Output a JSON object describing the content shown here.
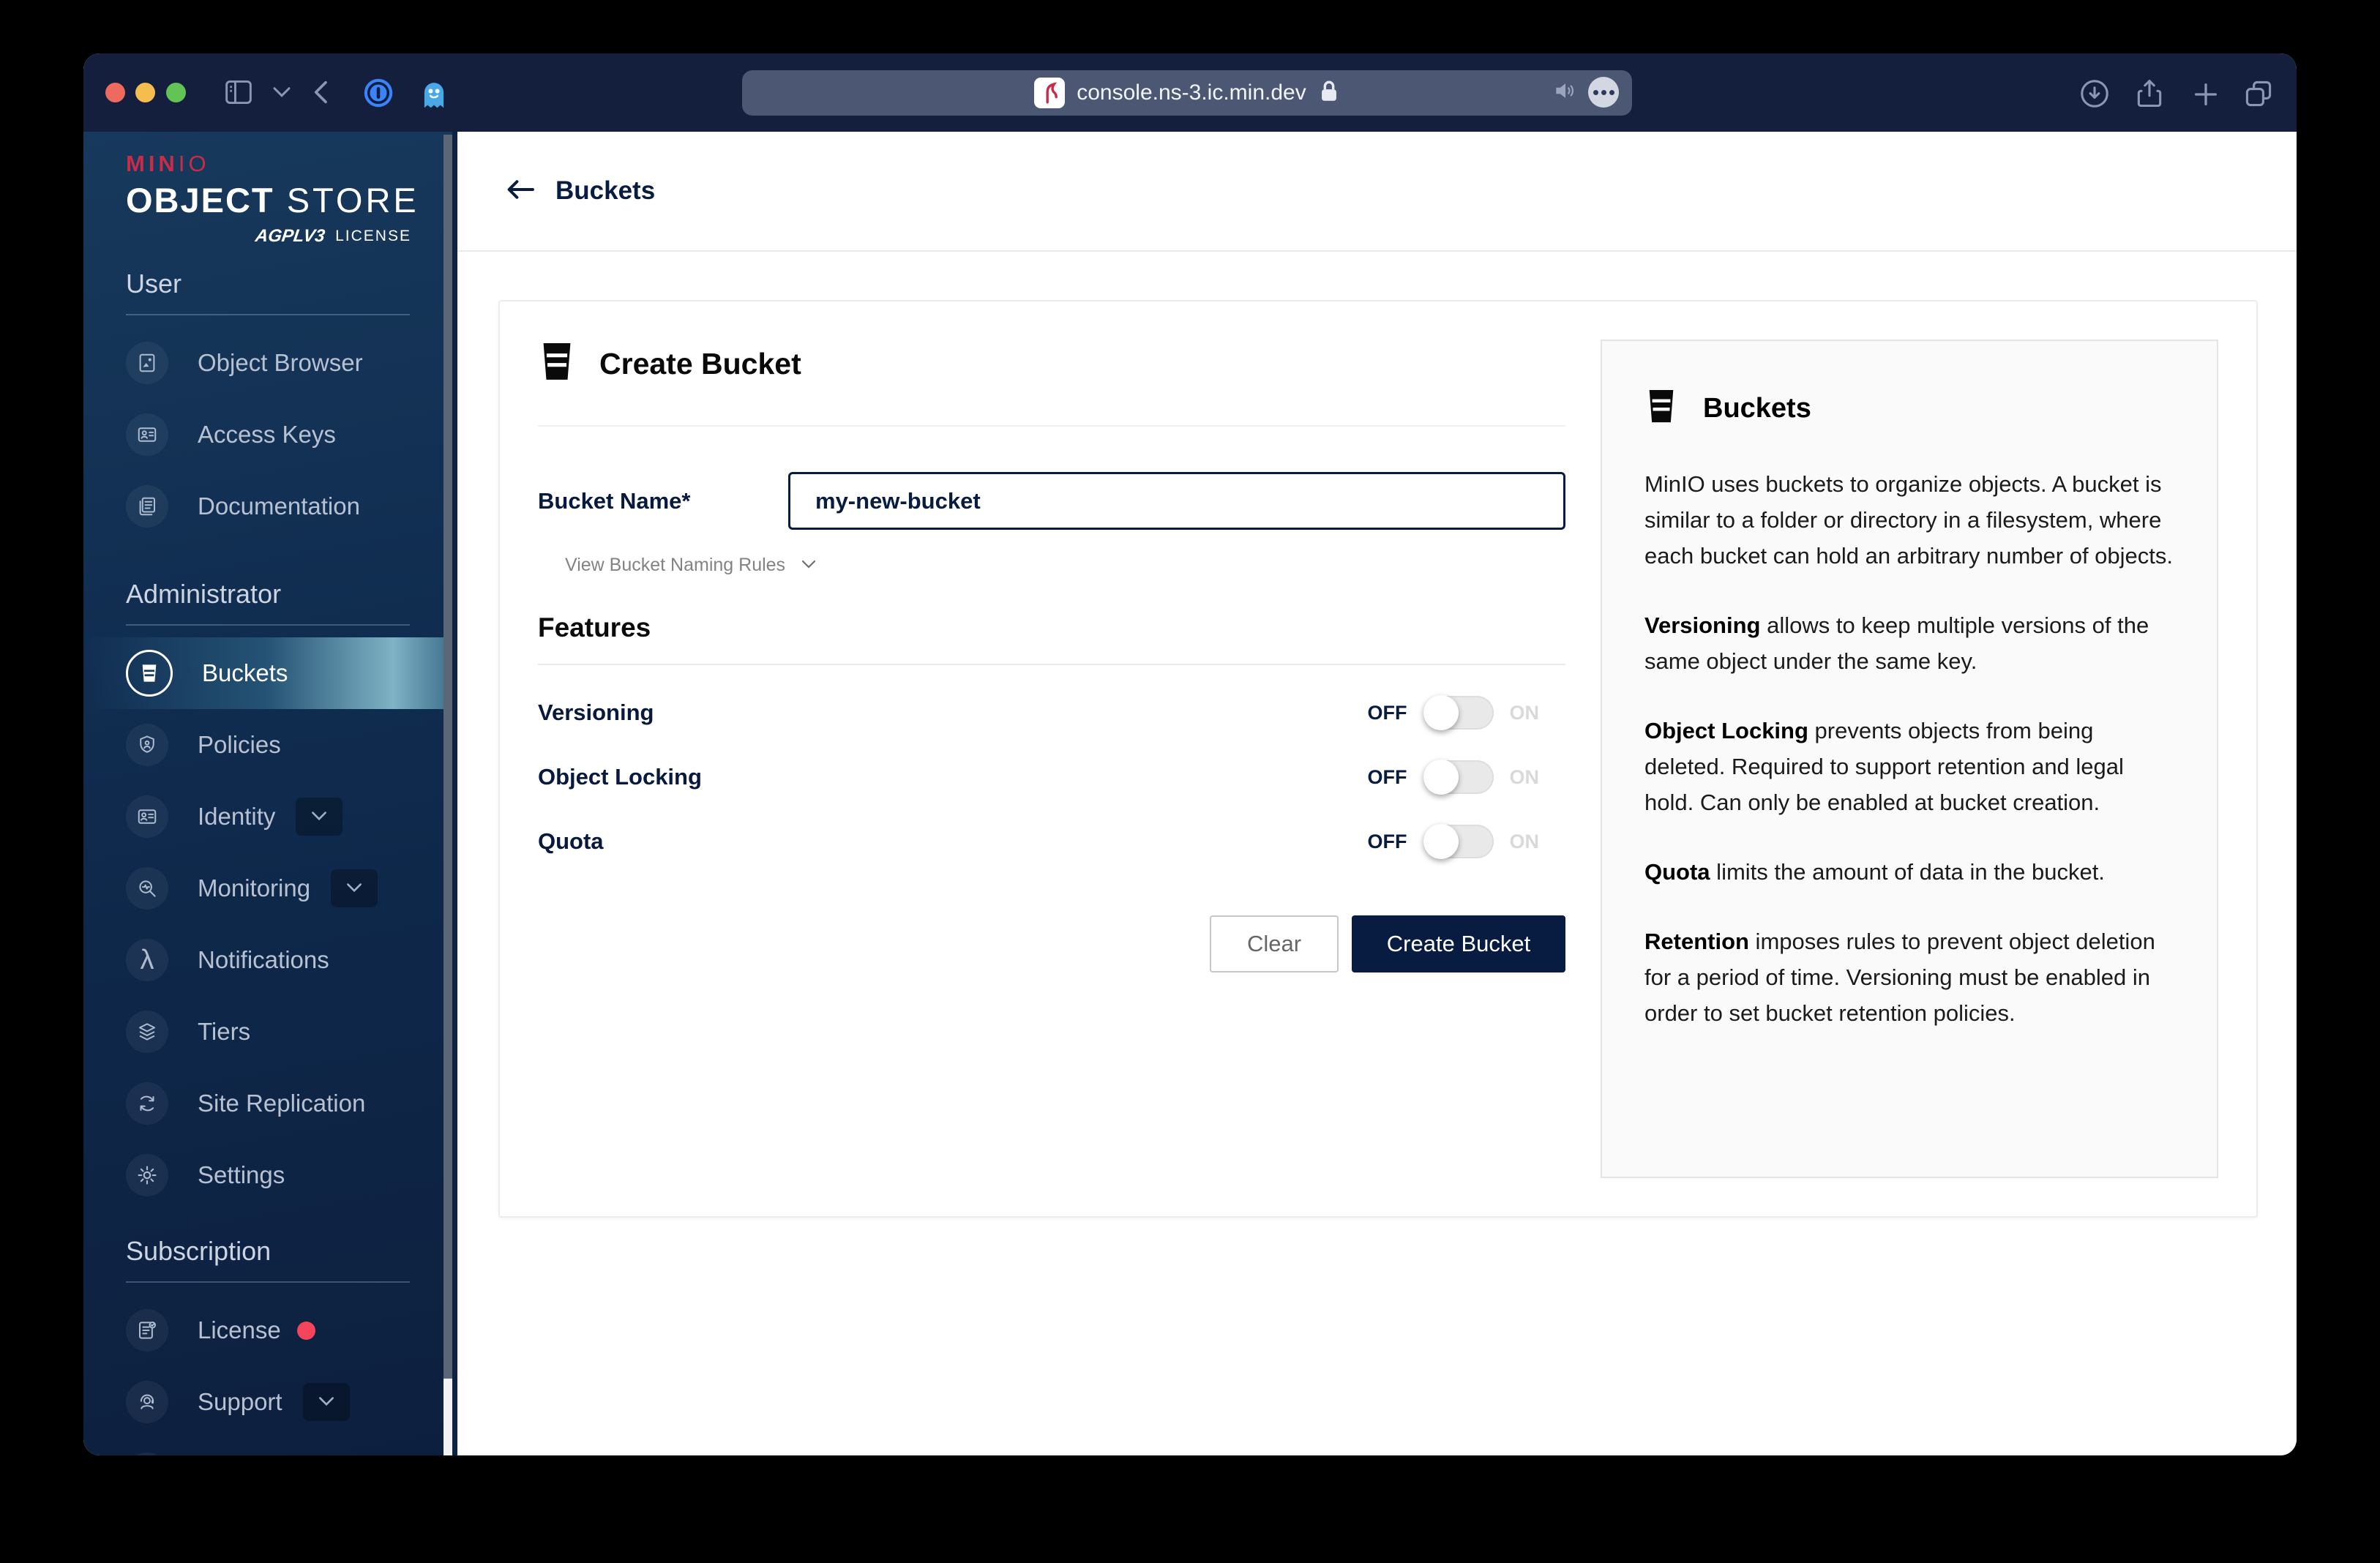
{
  "browser": {
    "url": "console.ns-3.ic.min.dev"
  },
  "logo": {
    "min": "MIN",
    "io": "IO",
    "object": "OBJECT",
    "store": " STORE",
    "agpl": "AGPLV3",
    "license": "LICENSE"
  },
  "sidebar": {
    "sections": [
      {
        "title": "User",
        "items": [
          {
            "label": "Object Browser"
          },
          {
            "label": "Access Keys"
          },
          {
            "label": "Documentation"
          }
        ]
      },
      {
        "title": "Administrator",
        "items": [
          {
            "label": "Buckets"
          },
          {
            "label": "Policies"
          },
          {
            "label": "Identity"
          },
          {
            "label": "Monitoring"
          },
          {
            "label": "Notifications"
          },
          {
            "label": "Tiers"
          },
          {
            "label": "Site Replication"
          },
          {
            "label": "Settings"
          }
        ]
      },
      {
        "title": "Subscription",
        "items": [
          {
            "label": "License"
          },
          {
            "label": "Support"
          }
        ]
      }
    ]
  },
  "page": {
    "title": "Buckets"
  },
  "form": {
    "title": "Create Bucket",
    "bucket_name_label": "Bucket Name*",
    "bucket_name_value": "my-new-bucket",
    "naming_rules_label": "View Bucket Naming Rules",
    "features_title": "Features",
    "toggles": [
      {
        "label": "Versioning"
      },
      {
        "label": "Object Locking"
      },
      {
        "label": "Quota"
      }
    ],
    "off": "OFF",
    "on": "ON",
    "clear_label": "Clear",
    "submit_label": "Create Bucket"
  },
  "info": {
    "title": "Buckets",
    "paragraphs": [
      {
        "bold": "",
        "text": "MinIO uses buckets to organize objects. A bucket is similar to a folder or directory in a filesystem, where each bucket can hold an arbitrary number of objects."
      },
      {
        "bold": "Versioning",
        "text": " allows to keep multiple versions of the same object under the same key."
      },
      {
        "bold": "Object Locking",
        "text": " prevents objects from being deleted. Required to support retention and legal hold. Can only be enabled at bucket creation."
      },
      {
        "bold": "Quota",
        "text": " limits the amount of data in the bucket."
      },
      {
        "bold": "Retention",
        "text": " imposes rules to prevent object deletion for a period of time. Versioning must be enabled in order to set bucket retention policies."
      }
    ]
  },
  "colors": {
    "navy": "#081C42",
    "brand_red": "#C72C48",
    "alert_red": "#F5455C",
    "selected_teal": "#7FB2C4"
  }
}
